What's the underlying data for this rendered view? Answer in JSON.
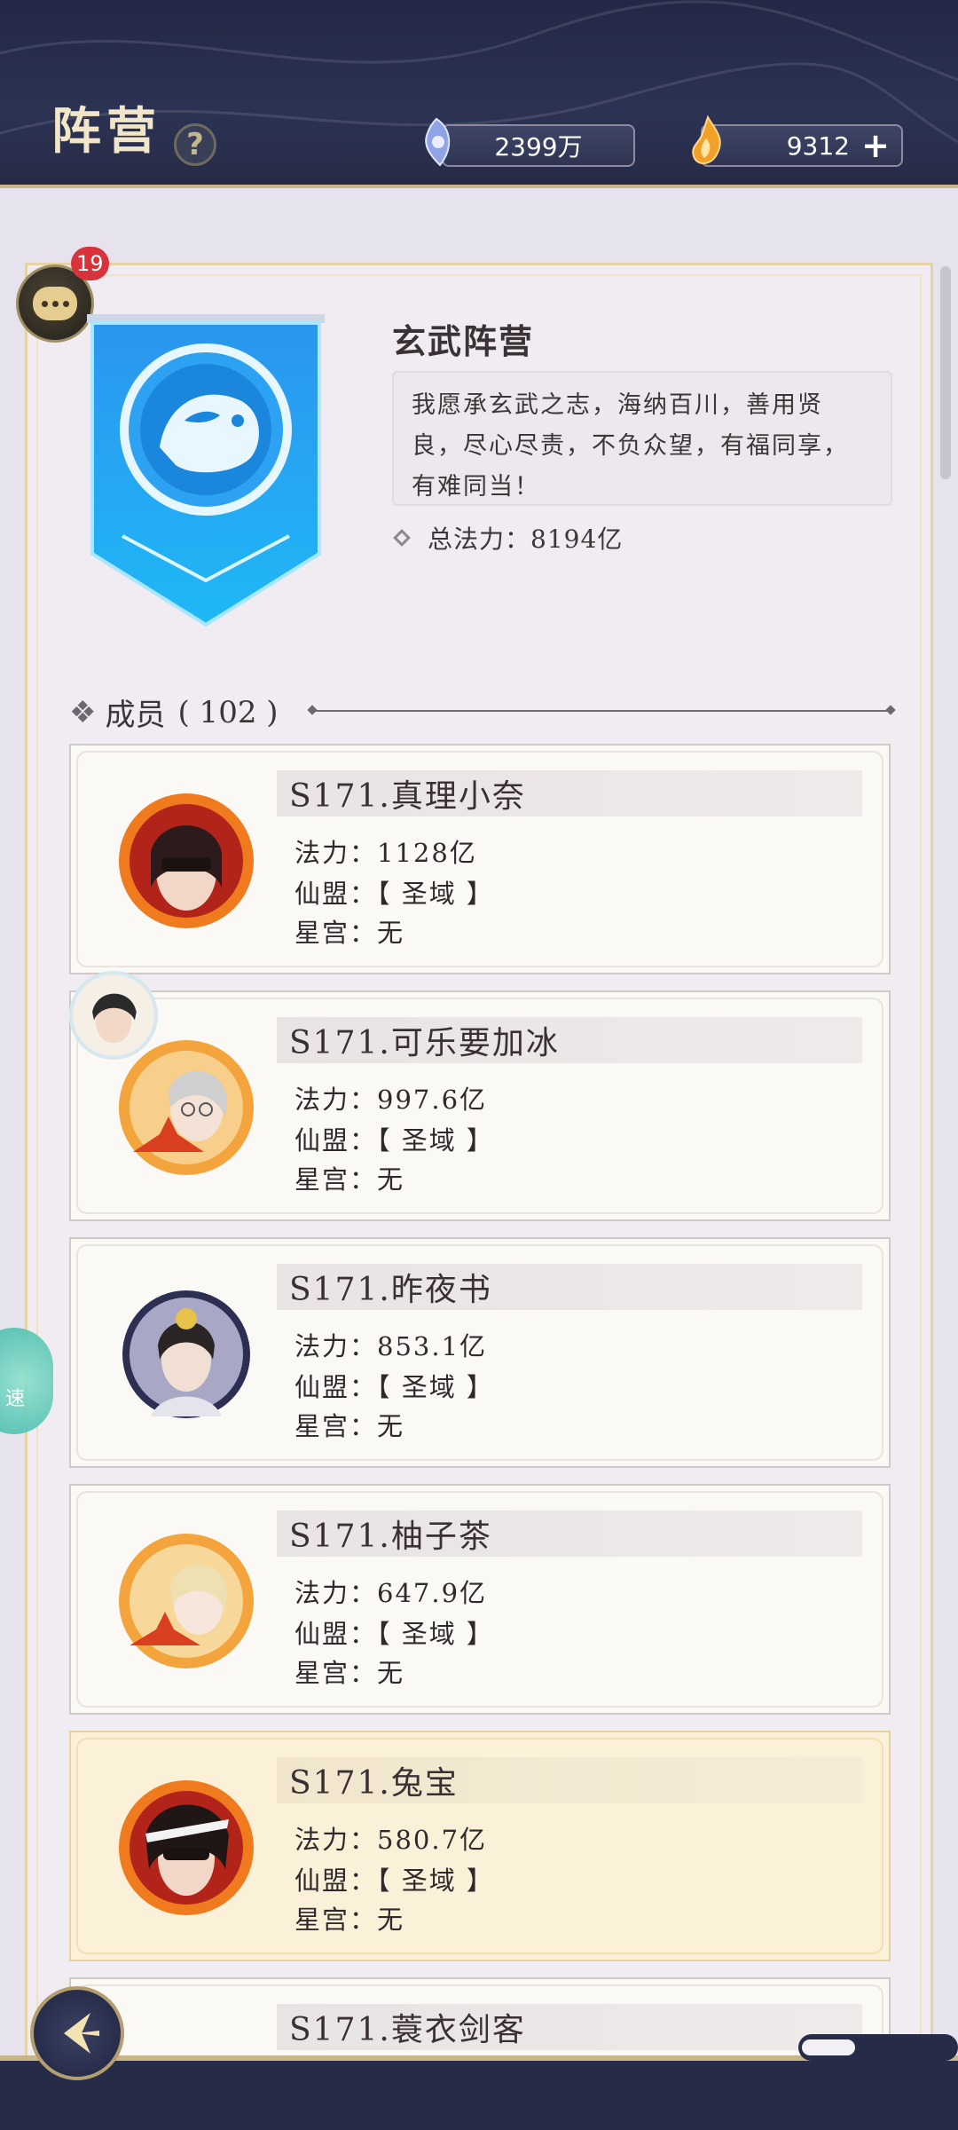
{
  "header": {
    "title": "阵营",
    "help_icon": "?",
    "currency1_value": "2399万",
    "currency2_value": "9312",
    "plus_label": "+"
  },
  "chat": {
    "badge_count": "19"
  },
  "faction": {
    "name": "玄武阵营",
    "motto": "我愿承玄武之志，海纳百川，善用贤良，尽心尽责，不负众望，有福同享，有难同当！",
    "power_text": "总法力：8194亿"
  },
  "members": {
    "label": "成员",
    "count_text": "( 102 )",
    "list": [
      {
        "name": "S171.真理小奈",
        "power": "法力：1128亿",
        "alliance": "仙盟：【 圣域 】",
        "palace": "星宫：无"
      },
      {
        "name": "S171.可乐要加冰",
        "power": "法力：997.6亿",
        "alliance": "仙盟：【 圣域 】",
        "palace": "星宫：无"
      },
      {
        "name": "S171.昨夜书",
        "power": "法力：853.1亿",
        "alliance": "仙盟：【 圣域 】",
        "palace": "星宫：无"
      },
      {
        "name": "S171.柚子茶",
        "power": "法力：647.9亿",
        "alliance": "仙盟：【 圣域 】",
        "palace": "星宫：无"
      },
      {
        "name": "S171.兔宝",
        "power": "法力：580.7亿",
        "alliance": "仙盟：【 圣域 】",
        "palace": "星宫：无"
      },
      {
        "name": "S171.蓑衣剑客"
      }
    ]
  },
  "side_float": {
    "label": "速"
  },
  "colors": {
    "accent_gold": "#c9b58a",
    "banner_blue": "#2aa7f0",
    "highlight_card": "#fbf1d8"
  }
}
